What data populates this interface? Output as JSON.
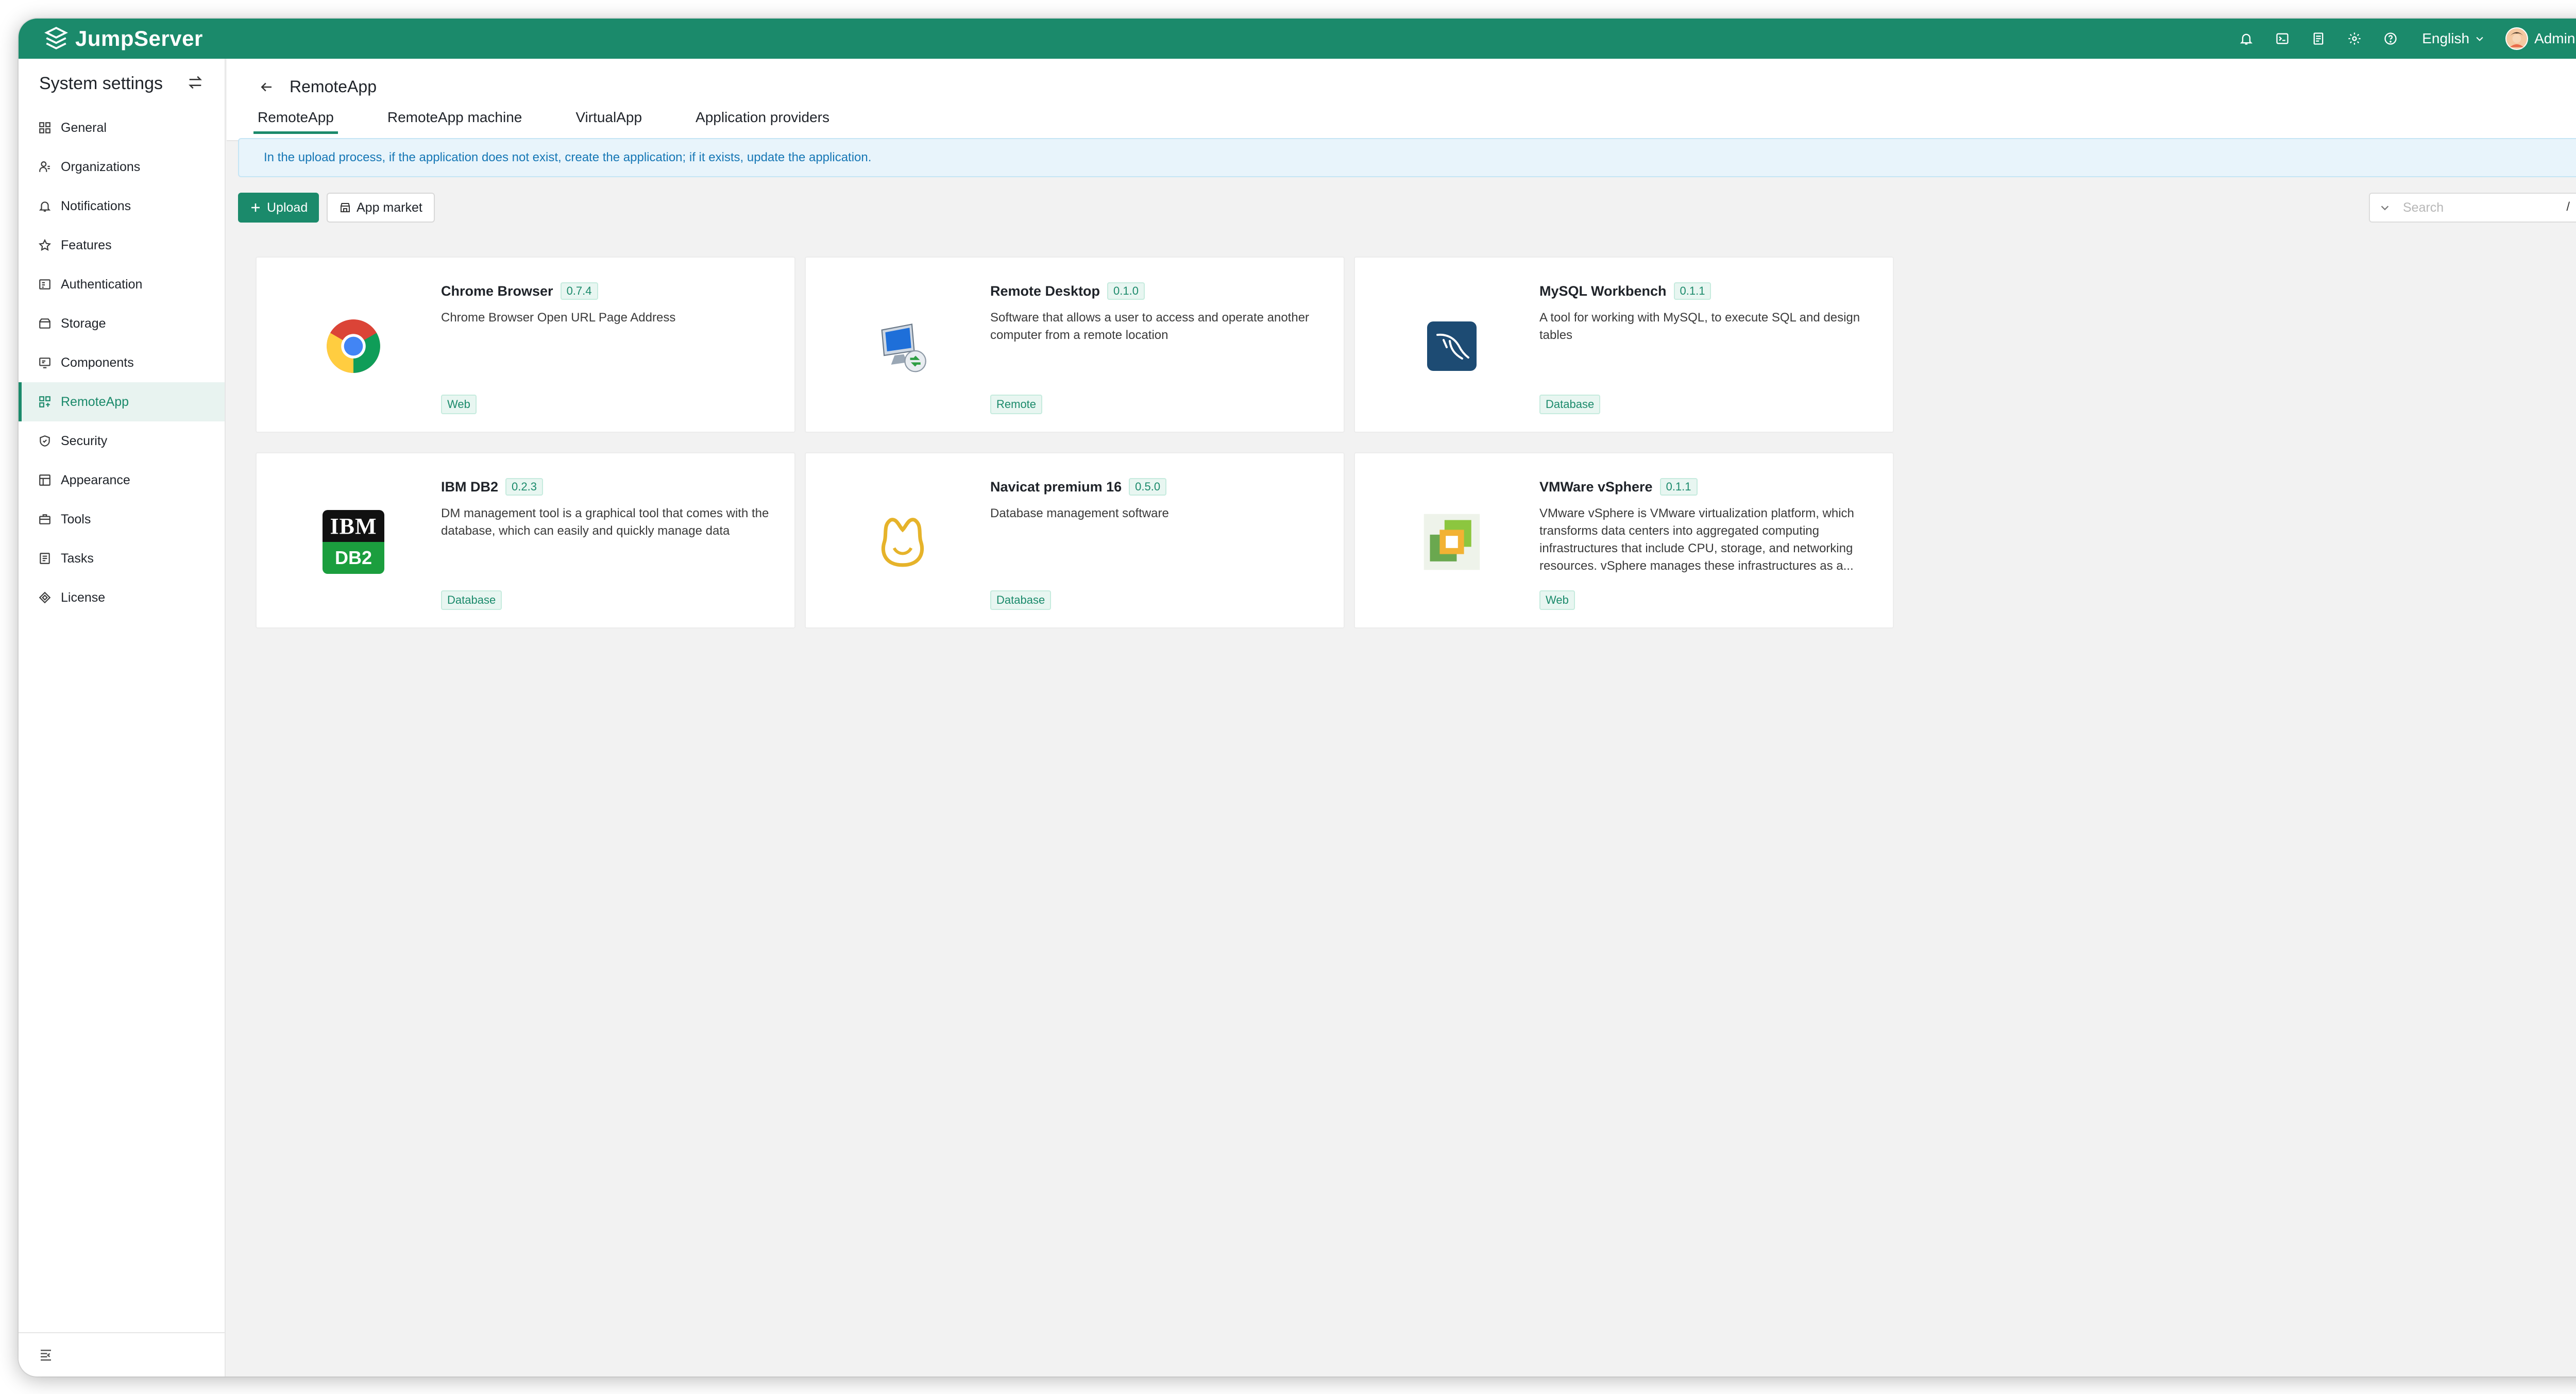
{
  "header": {
    "brand": "JumpServer",
    "language": "English",
    "user": "Administrator",
    "icons": [
      "bell-icon",
      "terminal-icon",
      "ticket-icon",
      "settings-icon",
      "help-icon"
    ]
  },
  "sidebar": {
    "title": "System settings",
    "items": [
      {
        "label": "General",
        "icon": "grid-icon"
      },
      {
        "label": "Organizations",
        "icon": "org-icon"
      },
      {
        "label": "Notifications",
        "icon": "bell-icon"
      },
      {
        "label": "Features",
        "icon": "star-icon"
      },
      {
        "label": "Authentication",
        "icon": "id-card-icon"
      },
      {
        "label": "Storage",
        "icon": "storage-icon"
      },
      {
        "label": "Components",
        "icon": "component-icon"
      },
      {
        "label": "RemoteApp",
        "icon": "apps-icon",
        "active": true
      },
      {
        "label": "Security",
        "icon": "shield-icon"
      },
      {
        "label": "Appearance",
        "icon": "palette-icon"
      },
      {
        "label": "Tools",
        "icon": "toolbox-icon"
      },
      {
        "label": "Tasks",
        "icon": "tasks-icon"
      },
      {
        "label": "License",
        "icon": "license-icon"
      }
    ]
  },
  "page": {
    "title": "RemoteApp",
    "tabs": [
      "RemoteApp",
      "RemoteApp machine",
      "VirtualApp",
      "Application providers"
    ],
    "active_tab": "RemoteApp",
    "alert": "In the upload process, if the application does not exist, create the application; if it exists, update the application."
  },
  "toolbar": {
    "upload_label": "Upload",
    "market_label": "App market",
    "search_placeholder": "Search",
    "search_shortcut": "/"
  },
  "apps": [
    {
      "name": "Chrome Browser",
      "version": "0.7.4",
      "description": "Chrome Browser Open URL Page Address",
      "tag": "Web",
      "icon": "chrome-icon"
    },
    {
      "name": "Remote Desktop",
      "version": "0.1.0",
      "description": "Software that allows a user to access and operate another computer from a remote location",
      "tag": "Remote",
      "icon": "remote-desktop-icon"
    },
    {
      "name": "MySQL Workbench",
      "version": "0.1.1",
      "description": "A tool for working with MySQL, to execute SQL and design tables",
      "tag": "Database",
      "icon": "mysql-icon"
    },
    {
      "name": "IBM DB2",
      "version": "0.2.3",
      "description": "DM management tool is a graphical tool that comes with the database, which can easily and quickly manage data",
      "tag": "Database",
      "icon": "db2-icon",
      "icon_text_top": "IBM",
      "icon_text_bottom": "DB2"
    },
    {
      "name": "Navicat premium 16",
      "version": "0.5.0",
      "description": "Database management software",
      "tag": "Database",
      "icon": "navicat-icon"
    },
    {
      "name": "VMWare vSphere",
      "version": "0.1.1",
      "description": "VMware vSphere is VMware virtualization platform, which transforms data centers into aggregated computing infrastructures that include CPU, storage, and networking resources. vSphere manages these infrastructures as a...",
      "tag": "Web",
      "icon": "vsphere-icon"
    }
  ],
  "colors": {
    "brand": "#1b8a6b",
    "alert_bg": "#e8f4fb",
    "alert_text": "#1677b5"
  }
}
